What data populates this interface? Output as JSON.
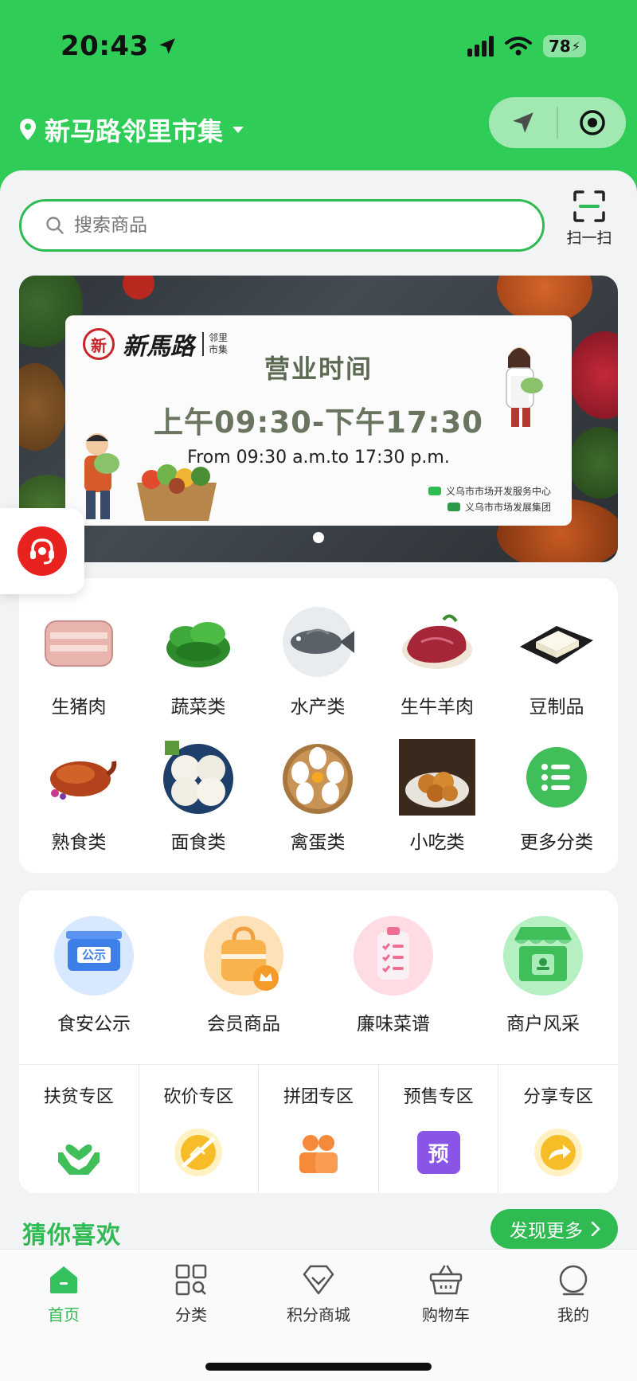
{
  "status_bar": {
    "time": "20:43",
    "battery": "78"
  },
  "header": {
    "location_name": "新马路邻里市集",
    "colors": {
      "primary": "#2fcc57",
      "accent": "#2fba52"
    }
  },
  "search": {
    "placeholder": "搜索商品",
    "scan_label": "扫一扫"
  },
  "banner": {
    "brand_name": "新馬路",
    "brand_sub_1": "邻里",
    "brand_sub_2": "市集",
    "title": "营业时间",
    "hours_cn": "上午09:30-下午17:30",
    "hours_en": "From 09:30 a.m.to 17:30 p.m.",
    "org_1": "义乌市市场开发服务中心",
    "org_2": "义乌市市场发展集团"
  },
  "categories": [
    {
      "label": "生猪肉",
      "icon": "pork-icon"
    },
    {
      "label": "蔬菜类",
      "icon": "vegetable-icon"
    },
    {
      "label": "水产类",
      "icon": "fish-icon"
    },
    {
      "label": "生牛羊肉",
      "icon": "beef-icon"
    },
    {
      "label": "豆制品",
      "icon": "tofu-icon"
    },
    {
      "label": "熟食类",
      "icon": "roast-duck-icon"
    },
    {
      "label": "面食类",
      "icon": "noodle-icon"
    },
    {
      "label": "禽蛋类",
      "icon": "egg-icon"
    },
    {
      "label": "小吃类",
      "icon": "snack-icon"
    },
    {
      "label": "更多分类",
      "icon": "more-categories-icon"
    }
  ],
  "features": [
    {
      "label": "食安公示",
      "badge": "公示",
      "icon": "notice-board-icon"
    },
    {
      "label": "会员商品",
      "icon": "member-bag-icon"
    },
    {
      "label": "廉味菜谱",
      "icon": "recipe-clipboard-icon"
    },
    {
      "label": "商户风采",
      "icon": "storefront-icon"
    }
  ],
  "zones": [
    {
      "label": "扶贫专区",
      "icon": "helping-heart-icon"
    },
    {
      "label": "砍价专区",
      "icon": "bargain-icon"
    },
    {
      "label": "拼团专区",
      "icon": "group-buy-icon"
    },
    {
      "label": "预售专区",
      "icon": "presale-icon",
      "glyph": "预"
    },
    {
      "label": "分享专区",
      "icon": "share-icon"
    }
  ],
  "guess": {
    "title": "猜你喜欢",
    "more_label": "发现更多"
  },
  "tabbar": [
    {
      "label": "首页",
      "icon": "home-icon",
      "active": true
    },
    {
      "label": "分类",
      "icon": "category-grid-icon"
    },
    {
      "label": "积分商城",
      "icon": "points-mall-icon"
    },
    {
      "label": "购物车",
      "icon": "cart-icon"
    },
    {
      "label": "我的",
      "icon": "profile-icon"
    }
  ]
}
